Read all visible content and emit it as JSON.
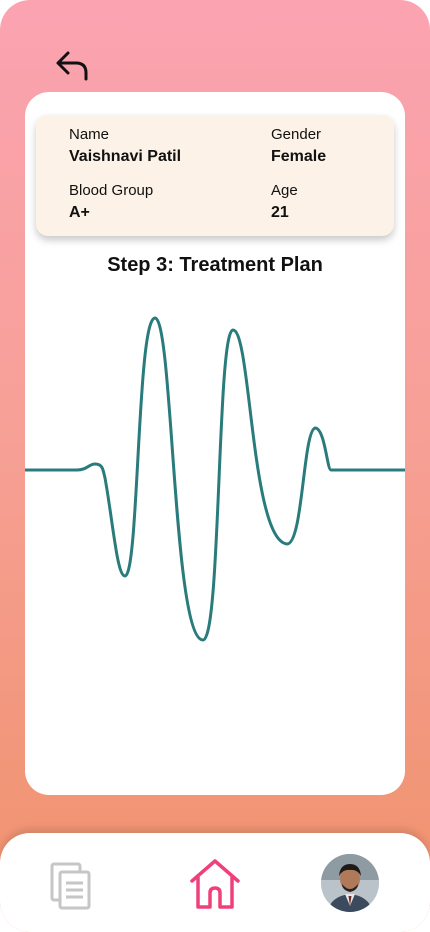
{
  "header": {
    "back_icon": "back-arrow-icon"
  },
  "patient": {
    "name_label": "Name",
    "name_value": "Vaishnavi Patil",
    "gender_label": "Gender",
    "gender_value": "Female",
    "blood_group_label": "Blood Group",
    "blood_group_value": "A+",
    "age_label": "Age",
    "age_value": "21"
  },
  "step": {
    "title": "Step 3: Treatment Plan"
  },
  "colors": {
    "wave": "#2a7b7b",
    "gradient_top": "#fba3b1",
    "gradient_bottom": "#f0926c",
    "home_accent": "#f0407a"
  },
  "nav": {
    "items": [
      {
        "icon": "documents-icon",
        "active": false
      },
      {
        "icon": "home-icon",
        "active": true
      },
      {
        "icon": "profile-avatar",
        "active": false
      }
    ]
  }
}
